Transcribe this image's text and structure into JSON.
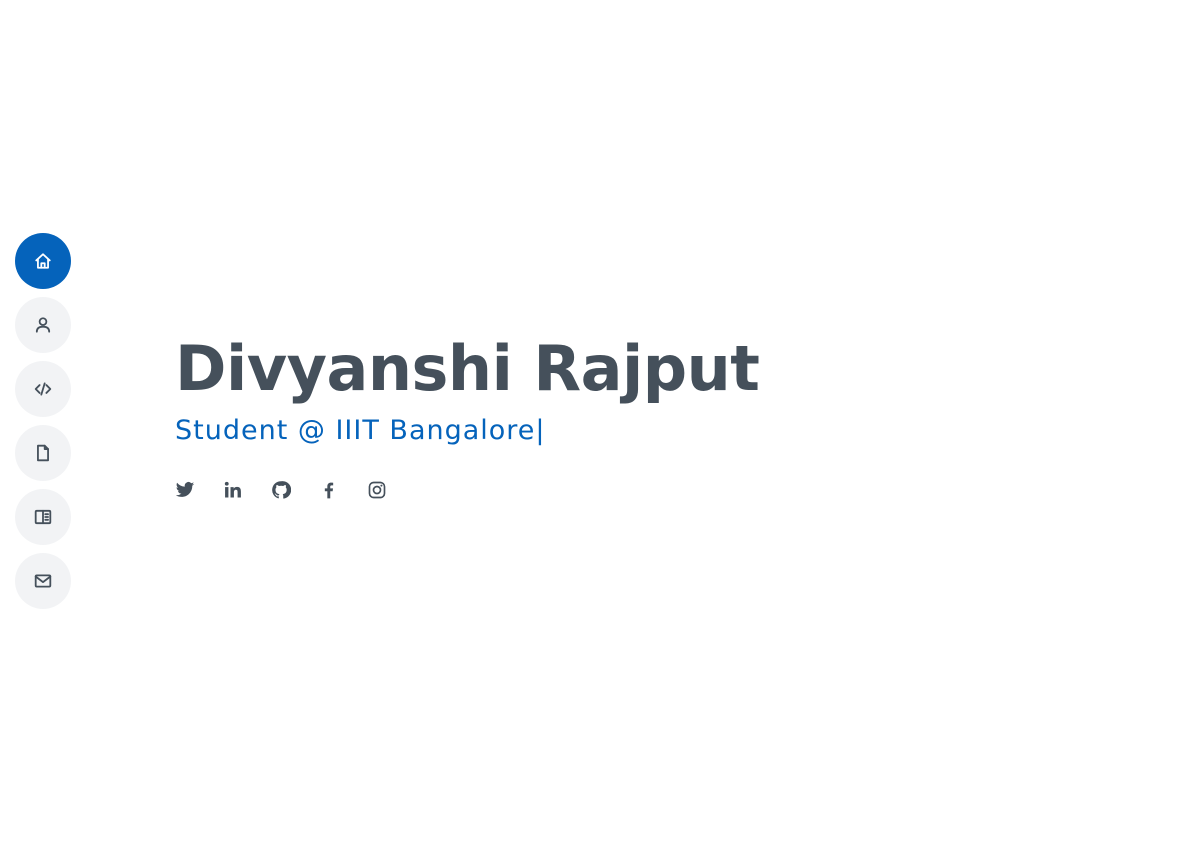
{
  "nav": {
    "items": [
      {
        "name": "home",
        "icon": "home-icon",
        "active": true
      },
      {
        "name": "about",
        "icon": "person-icon",
        "active": false
      },
      {
        "name": "skills",
        "icon": "code-icon",
        "active": false
      },
      {
        "name": "resume",
        "icon": "file-icon",
        "active": false
      },
      {
        "name": "portfolio",
        "icon": "book-icon",
        "active": false
      },
      {
        "name": "contact",
        "icon": "envelope-icon",
        "active": false
      }
    ]
  },
  "hero": {
    "name": "Divyanshi Rajput",
    "subtitle": "Student @ IIIT Bangalore",
    "cursor": "|"
  },
  "social": [
    {
      "icon": "twitter-icon"
    },
    {
      "icon": "linkedin-icon"
    },
    {
      "icon": "github-icon"
    },
    {
      "icon": "facebook-icon"
    },
    {
      "icon": "instagram-icon"
    }
  ],
  "colors": {
    "accent": "#0563bb",
    "text": "#45505b",
    "nav_bg": "#f2f3f5"
  }
}
